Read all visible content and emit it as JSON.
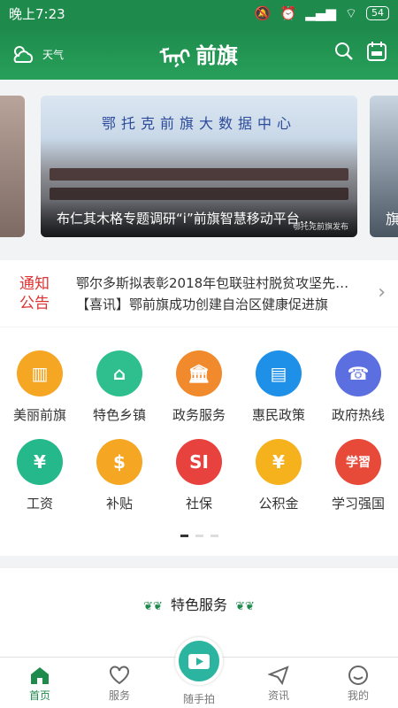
{
  "status": {
    "time": "晚上7:23",
    "battery": "54"
  },
  "header": {
    "weather_label": "天气",
    "logo_text": "前旗",
    "logo_script": "ᠮᠡᠨᠢ"
  },
  "banner": {
    "wall_text": "鄂托克前旗大数据中心",
    "caption": "布仁其木格专题调研“i”前旗智慧移动平台…",
    "source": "鄂托克前旗发布",
    "side_caption": "旗"
  },
  "notice": {
    "tag_line1": "通知",
    "tag_line2": "公告",
    "line1": "鄂尔多斯拟表彰2018年包联驻村脱贫攻坚先…",
    "line2": "【喜讯】鄂前旗成功创建自治区健康促进旗"
  },
  "grid": {
    "items": [
      {
        "label": "美丽前旗",
        "glyph": "▥",
        "color": "#f5a623"
      },
      {
        "label": "特色乡镇",
        "glyph": "⌂",
        "color": "#2fbf8f"
      },
      {
        "label": "政务服务",
        "glyph": "🏛",
        "color": "#f08a2c"
      },
      {
        "label": "惠民政策",
        "glyph": "▤",
        "color": "#1e90e8"
      },
      {
        "label": "政府热线",
        "glyph": "☎",
        "color": "#5b6fe0"
      },
      {
        "label": "工资",
        "glyph": "¥",
        "color": "#25b88a"
      },
      {
        "label": "补贴",
        "glyph": "$",
        "color": "#f5a623"
      },
      {
        "label": "社保",
        "glyph": "SI",
        "color": "#e8423f"
      },
      {
        "label": "公积金",
        "glyph": "¥",
        "color": "#f5b21d"
      },
      {
        "label": "学习强国",
        "glyph": "学習",
        "color": "#e84a3a"
      }
    ]
  },
  "special": {
    "title": "特色服务"
  },
  "tabbar": {
    "home": "首页",
    "service": "服务",
    "shoot": "随手拍",
    "news": "资讯",
    "mine": "我的"
  }
}
